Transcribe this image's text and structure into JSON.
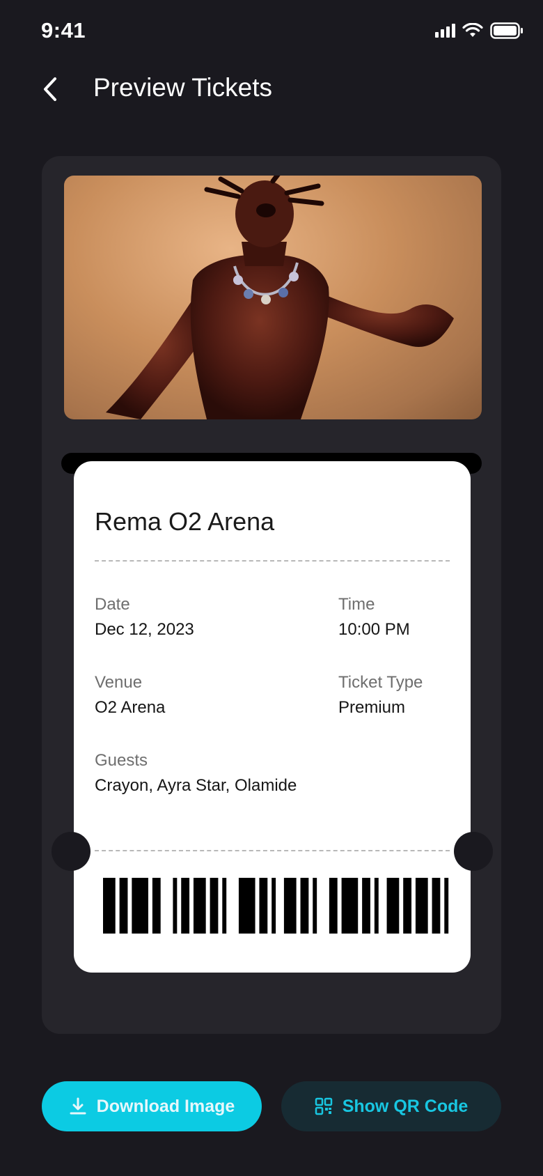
{
  "status_bar": {
    "time": "9:41"
  },
  "header": {
    "title": "Preview Tickets"
  },
  "ticket": {
    "event_name": "Rema O2 Arena",
    "fields": {
      "date_label": "Date",
      "date_value": "Dec 12, 2023",
      "time_label": "Time",
      "time_value": "10:00 PM",
      "venue_label": "Venue",
      "venue_value": "O2 Arena",
      "type_label": "Ticket Type",
      "type_value": "Premium",
      "guests_label": "Guests",
      "guests_value": "Crayon, Ayra Star, Olamide"
    }
  },
  "actions": {
    "download_label": "Download Image",
    "qr_label": "Show QR Code"
  },
  "colors": {
    "background": "#1a191f",
    "card": "#26252b",
    "accent": "#0ccbe3",
    "qr_button_bg": "#172b33"
  },
  "icons": {
    "back": "chevron-left-icon",
    "download": "download-icon",
    "qr": "qr-code-icon",
    "signal": "cellular-signal-icon",
    "wifi": "wifi-icon",
    "battery": "battery-icon"
  }
}
